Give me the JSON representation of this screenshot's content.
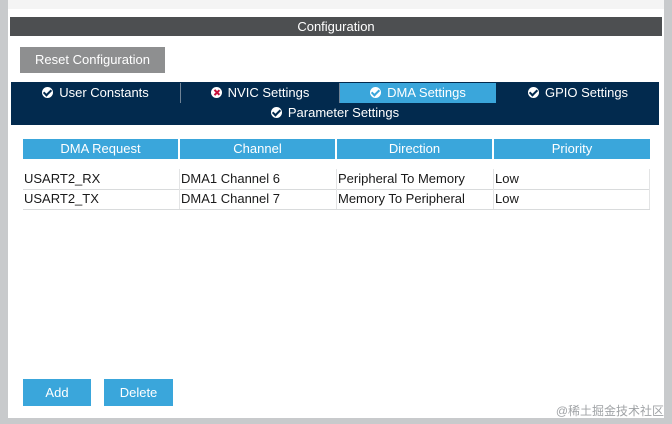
{
  "panel": {
    "title": "Configuration"
  },
  "toolbar": {
    "reset_label": "Reset Configuration"
  },
  "tabs": [
    {
      "label": "User Constants",
      "icon": "check-icon",
      "active": false
    },
    {
      "label": "NVIC Settings",
      "icon": "error-icon",
      "active": false
    },
    {
      "label": "DMA Settings",
      "icon": "check-icon",
      "active": true
    },
    {
      "label": "GPIO Settings",
      "icon": "check-icon",
      "active": false
    },
    {
      "label": "Parameter Settings",
      "icon": "check-icon",
      "active": false
    }
  ],
  "table": {
    "headers": [
      "DMA Request",
      "Channel",
      "Direction",
      "Priority"
    ],
    "rows": [
      [
        "USART2_RX",
        "DMA1 Channel 6",
        "Peripheral To Memory",
        "Low"
      ],
      [
        "USART2_TX",
        "DMA1 Channel 7",
        "Memory To Peripheral",
        "Low"
      ]
    ]
  },
  "actions": {
    "add_label": "Add",
    "delete_label": "Delete"
  },
  "watermark": "@稀土掘金技术社区",
  "colors": {
    "accent": "#3aa6db",
    "tab_bar": "#022a4e",
    "title_bar": "#4d4f51",
    "error": "#c8103b"
  }
}
